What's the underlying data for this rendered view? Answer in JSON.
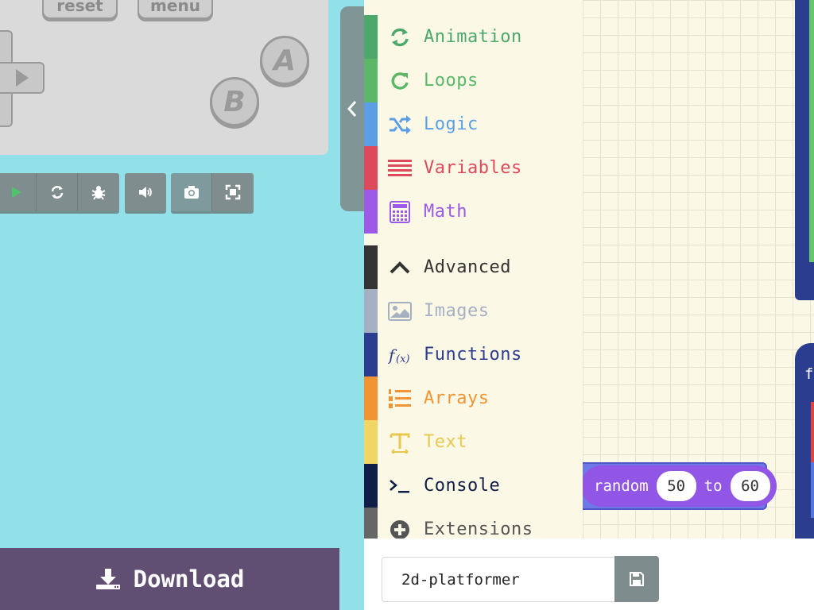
{
  "simulator": {
    "reset_label": "reset",
    "menu_label": "menu",
    "a_label": "A",
    "b_label": "B",
    "toolbar": [
      {
        "name": "play-icon"
      },
      {
        "name": "restart-icon"
      },
      {
        "name": "debug-icon"
      },
      {
        "name": "volume-icon"
      },
      {
        "name": "screenshot-icon"
      },
      {
        "name": "fullscreen-icon"
      }
    ],
    "download_label": "Download"
  },
  "toolbox": {
    "categories": [
      {
        "label": "Animation",
        "color": "#4ca86b",
        "icon": "animation-icon"
      },
      {
        "label": "Loops",
        "color": "#5cb868",
        "icon": "loops-icon"
      },
      {
        "label": "Logic",
        "color": "#5c9ee6",
        "icon": "logic-icon"
      },
      {
        "label": "Variables",
        "color": "#dd4a5c",
        "icon": "variables-icon"
      },
      {
        "label": "Math",
        "color": "#9d5ae6",
        "icon": "math-icon"
      },
      {
        "label": "Advanced",
        "color": "#333333",
        "icon": "chevron-up-icon"
      },
      {
        "label": "Images",
        "color": "#a5b0c2",
        "icon": "images-icon"
      },
      {
        "label": "Functions",
        "color": "#2b3d8f",
        "icon": "functions-icon"
      },
      {
        "label": "Arrays",
        "color": "#f19534",
        "icon": "arrays-icon"
      },
      {
        "label": "Text",
        "color": "#f0d665",
        "icon": "text-icon"
      },
      {
        "label": "Console",
        "color": "#0f1e47",
        "icon": "console-icon"
      },
      {
        "label": "Extensions",
        "color": "#666666",
        "icon": "extensions-icon"
      }
    ]
  },
  "workspace": {
    "random_block": {
      "prefix": "random",
      "from": "50",
      "to_label": "to",
      "to": "60"
    },
    "partial_label": "f"
  },
  "project": {
    "name": "2d-platformer",
    "save_icon": "save-icon"
  }
}
